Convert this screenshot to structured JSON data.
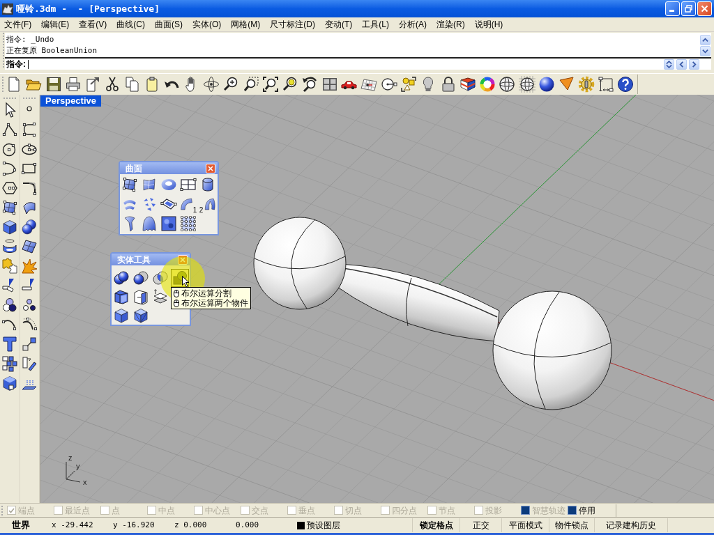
{
  "window": {
    "title": "哑铃.3dm -  - [Perspective]"
  },
  "menu_bar": [
    {
      "label": "文件(F)"
    },
    {
      "label": "编辑(E)"
    },
    {
      "label": "查看(V)"
    },
    {
      "label": "曲线(C)"
    },
    {
      "label": "曲面(S)"
    },
    {
      "label": "实体(O)"
    },
    {
      "label": "网格(M)"
    },
    {
      "label": "尺寸标注(D)"
    },
    {
      "label": "变动(T)"
    },
    {
      "label": "工具(L)"
    },
    {
      "label": "分析(A)"
    },
    {
      "label": "渲染(R)"
    },
    {
      "label": "说明(H)"
    }
  ],
  "command_area": {
    "history": [
      "指令: _Undo",
      "正在复原 BooleanUnion"
    ],
    "prompt": "指令:"
  },
  "viewport": {
    "title": "Perspective",
    "axis_labels": [
      "z",
      "y",
      "x"
    ]
  },
  "surface_toolbar": {
    "title": "曲面",
    "sweep_numbers": [
      "1",
      "2"
    ]
  },
  "solid_toolbar": {
    "title": "实体工具",
    "buttons": [
      {
        "hovered": false
      },
      {
        "hovered": false
      },
      {
        "hovered": false
      },
      {
        "hovered": true
      },
      {
        "hovered": false
      },
      {
        "hovered": false
      },
      {
        "hovered": false
      },
      {
        "hovered": false
      },
      {
        "hovered": false
      }
    ]
  },
  "tooltip": {
    "lines": [
      "布尔运算分割",
      "布尔运算两个物件"
    ]
  },
  "osnap_bar": [
    {
      "label": "端点",
      "kind": "osnap",
      "checked": true,
      "disabled": true
    },
    {
      "label": "最近点",
      "kind": "osnap",
      "checked": false,
      "disabled": true
    },
    {
      "label": "点",
      "kind": "osnap",
      "checked": false,
      "disabled": true
    },
    {
      "label": "中点",
      "kind": "osnap",
      "checked": false,
      "disabled": true
    },
    {
      "label": "中心点",
      "kind": "osnap",
      "checked": false,
      "disabled": true
    },
    {
      "label": "交点",
      "kind": "osnap",
      "checked": false,
      "disabled": true
    },
    {
      "label": "垂点",
      "kind": "osnap",
      "checked": false,
      "disabled": true
    },
    {
      "label": "切点",
      "kind": "osnap",
      "checked": false,
      "disabled": true
    },
    {
      "label": "四分点",
      "kind": "osnap",
      "checked": false,
      "disabled": true
    },
    {
      "label": "节点",
      "kind": "osnap",
      "checked": false,
      "disabled": true
    },
    {
      "label": "投影",
      "kind": "osnap",
      "checked": false,
      "disabled": true
    },
    {
      "label": "智慧轨迹",
      "kind": "toggle",
      "checked": true,
      "disabled": true
    },
    {
      "label": "停用",
      "kind": "toggle",
      "checked": true,
      "disabled": false
    }
  ],
  "status_bar": {
    "coordinate_system": "世界",
    "x": "x -29.442",
    "y": "y -16.920",
    "z": "z 0.000",
    "distance": "0.000",
    "layer": {
      "name": "预设图层",
      "color": "#000000"
    },
    "toggles": [
      {
        "label": "锁定格点",
        "on": true
      },
      {
        "label": "正交",
        "on": false
      },
      {
        "label": "平面模式",
        "on": false
      },
      {
        "label": "物件锁点",
        "on": false
      },
      {
        "label": "记录建构历史",
        "on": false
      }
    ]
  }
}
